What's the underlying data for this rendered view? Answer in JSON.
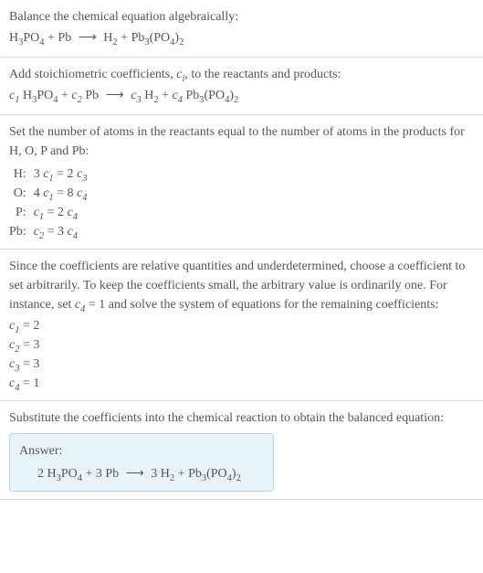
{
  "section1": {
    "line1": "Balance the chemical equation algebraically:",
    "equation_lhs_1": "H",
    "equation_lhs_1_sub": "3",
    "equation_lhs_2": "PO",
    "equation_lhs_2_sub": "4",
    "equation_plus": " + Pb ",
    "equation_arrow": "⟶",
    "equation_rhs_1": " H",
    "equation_rhs_1_sub": "2",
    "equation_rhs_plus": " + Pb",
    "equation_rhs_2_sub": "3",
    "equation_rhs_3": "(PO",
    "equation_rhs_3_sub": "4",
    "equation_rhs_4": ")",
    "equation_rhs_4_sub": "2"
  },
  "section2": {
    "line1_a": "Add stoichiometric coefficients, ",
    "line1_c": "c",
    "line1_i": "i",
    "line1_b": ", to the reactants and products:",
    "c1": "c",
    "c1_sub": "1",
    "sp1": " H",
    "sp1_sub": "3",
    "sp2": "PO",
    "sp2_sub": "4",
    "plus1": " + ",
    "c2": "c",
    "c2_sub": "2",
    "sp3": " Pb ",
    "arrow": "⟶",
    "sp4": " ",
    "c3": "c",
    "c3_sub": "3",
    "sp5": " H",
    "sp5_sub": "2",
    "plus2": " + ",
    "c4": "c",
    "c4_sub": "4",
    "sp6": " Pb",
    "sp6_sub": "3",
    "sp7": "(PO",
    "sp7_sub": "4",
    "sp8": ")",
    "sp8_sub": "2"
  },
  "section3": {
    "line1": "Set the number of atoms in the reactants equal to the number of atoms in the products for H, O, P and Pb:",
    "rows": {
      "H": {
        "label": "H:",
        "lhs_coef": "3 ",
        "lhs_c": "c",
        "lhs_sub": "1",
        "eq": " = 2 ",
        "rhs_c": "c",
        "rhs_sub": "3"
      },
      "O": {
        "label": "O:",
        "lhs_coef": "4 ",
        "lhs_c": "c",
        "lhs_sub": "1",
        "eq": " = 8 ",
        "rhs_c": "c",
        "rhs_sub": "4"
      },
      "P": {
        "label": "P:",
        "lhs_coef": "",
        "lhs_c": "c",
        "lhs_sub": "1",
        "eq": " = 2 ",
        "rhs_c": "c",
        "rhs_sub": "4"
      },
      "Pb": {
        "label": "Pb:",
        "lhs_coef": "",
        "lhs_c": "c",
        "lhs_sub": "2",
        "eq": " = 3 ",
        "rhs_c": "c",
        "rhs_sub": "4"
      }
    }
  },
  "section4": {
    "line1_a": "Since the coefficients are relative quantities and underdetermined, choose a coefficient to set arbitrarily. To keep the coefficients small, the arbitrary value is ordinarily one. For instance, set ",
    "line1_c": "c",
    "line1_sub": "4",
    "line1_b": " = 1 and solve the system of equations for the remaining coefficients:",
    "coefs": {
      "c1": {
        "c": "c",
        "sub": "1",
        "val": " = 2"
      },
      "c2": {
        "c": "c",
        "sub": "2",
        "val": " = 3"
      },
      "c3": {
        "c": "c",
        "sub": "3",
        "val": " = 3"
      },
      "c4": {
        "c": "c",
        "sub": "4",
        "val": " = 1"
      }
    }
  },
  "section5": {
    "line1": "Substitute the coefficients into the chemical reaction to obtain the balanced equation:",
    "answer_label": "Answer:",
    "answer": {
      "p1": "2 H",
      "s1": "3",
      "p2": "PO",
      "s2": "4",
      "p3": " + 3 Pb ",
      "arrow": "⟶",
      "p4": " 3 H",
      "s4": "2",
      "p5": " + Pb",
      "s5": "3",
      "p6": "(PO",
      "s6": "4",
      "p7": ")",
      "s7": "2"
    }
  }
}
